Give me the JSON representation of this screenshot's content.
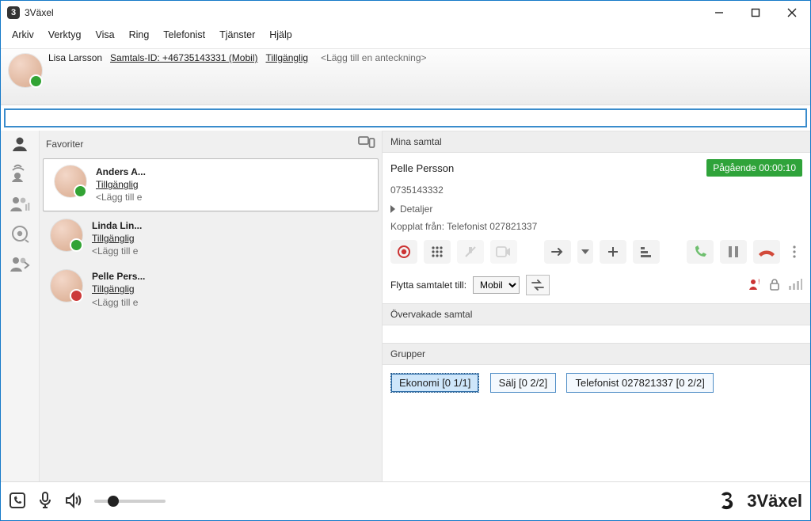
{
  "window": {
    "title": "3Växel"
  },
  "menu": {
    "arkiv": "Arkiv",
    "verktyg": "Verktyg",
    "visa": "Visa",
    "ring": "Ring",
    "telefonist": "Telefonist",
    "tjanster": "Tjänster",
    "hjalp": "Hjälp"
  },
  "identity": {
    "name": "Lisa Larsson",
    "caller_id_label": "Samtals-ID: +46735143331 (Mobil)",
    "availability": "Tillgänglig",
    "note_hint": "<Lägg till en anteckning>",
    "presence": "green"
  },
  "search": {
    "value": ""
  },
  "left": {
    "favorites_label": "Favoriter",
    "items": [
      {
        "name": "Anders A...",
        "status": "Tillgänglig",
        "note": "<Lägg till e",
        "presence": "green"
      },
      {
        "name": "Linda Lin...",
        "status": "Tillgänglig",
        "note": "<Lägg till e",
        "presence": "green"
      },
      {
        "name": "Pelle Pers...",
        "status": "Tillgänglig",
        "note": "<Lägg till e",
        "presence": "red"
      }
    ]
  },
  "right": {
    "mina_samtal": "Mina samtal",
    "call": {
      "name": "Pelle Persson",
      "status": "Pågående 00:00:10",
      "number": "0735143332",
      "details_label": "Detaljer",
      "kopplat": "Kopplat från: Telefonist 027821337",
      "move_label": "Flytta samtalet till:",
      "move_value": "Mobil"
    },
    "overvakade": "Övervakade samtal",
    "grupper": "Grupper",
    "groups": [
      {
        "label": "Ekonomi [0 1/1]"
      },
      {
        "label": "Sälj [0 2/2]"
      },
      {
        "label": "Telefonist 027821337 [0 2/2]"
      }
    ]
  },
  "brand": "3Växel"
}
